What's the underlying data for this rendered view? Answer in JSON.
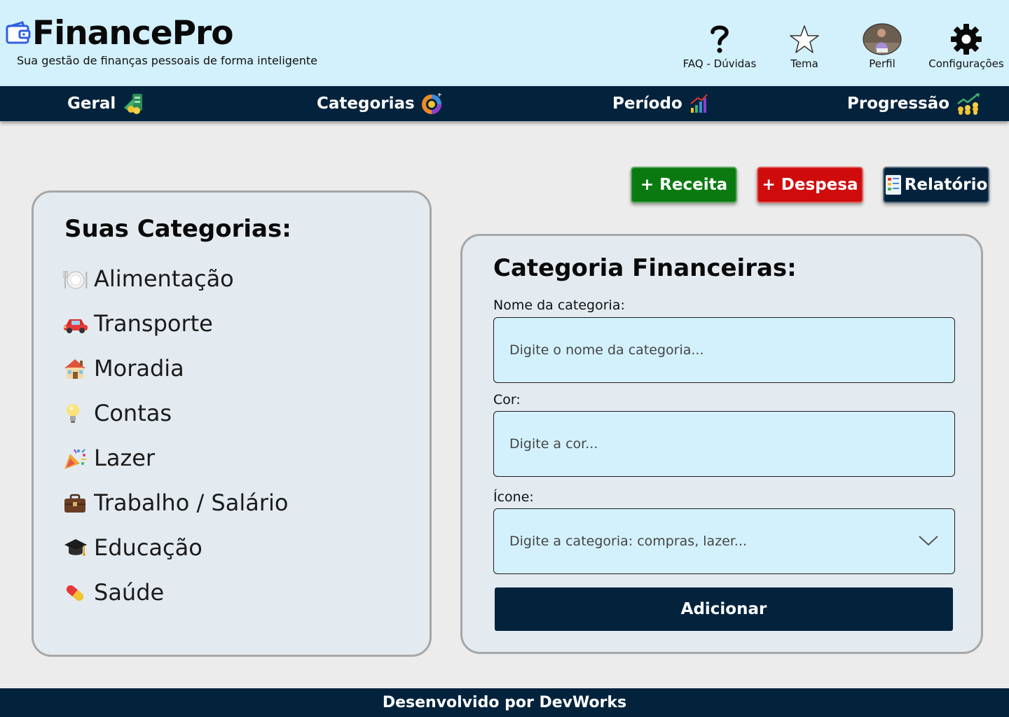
{
  "app": {
    "name": "FinancePro",
    "tagline": "Sua gestão de finanças pessoais de forma inteligente",
    "logo_icon": "wallet-icon"
  },
  "header_actions": [
    {
      "label": "FAQ - Dúvidas",
      "icon": "question-mark-icon"
    },
    {
      "label": "Tema",
      "icon": "star-icon"
    },
    {
      "label": "Perfil",
      "icon": "avatar"
    },
    {
      "label": "Configurações",
      "icon": "gear-icon"
    }
  ],
  "nav": [
    {
      "label": "Geral",
      "icon": "money-stack-icon"
    },
    {
      "label": "Categorias",
      "icon": "donut-chart-icon"
    },
    {
      "label": "Período",
      "icon": "bar-chart-icon"
    },
    {
      "label": "Progressão",
      "icon": "growth-chart-icon"
    }
  ],
  "actions": {
    "income": "+ Receita",
    "expense": "+ Despesa",
    "report": "Relatório"
  },
  "categories_panel": {
    "title": "Suas Categorias:",
    "items": [
      {
        "label": "Alimentação",
        "icon": "plate-icon"
      },
      {
        "label": "Transporte",
        "icon": "car-icon"
      },
      {
        "label": "Moradia",
        "icon": "house-icon"
      },
      {
        "label": "Contas",
        "icon": "lightbulb-icon"
      },
      {
        "label": "Lazer",
        "icon": "party-popper-icon"
      },
      {
        "label": "Trabalho / Salário",
        "icon": "briefcase-icon"
      },
      {
        "label": "Educação",
        "icon": "graduation-cap-icon"
      },
      {
        "label": "Saúde",
        "icon": "pill-icon"
      }
    ]
  },
  "form": {
    "title": "Categoria Financeiras:",
    "name_label": "Nome da categoria:",
    "name_placeholder": "Digite o nome da categoria...",
    "color_label": "Cor:",
    "color_placeholder": "Digite a cor...",
    "icon_label": "Ícone:",
    "icon_placeholder": "Digite a categoria: compras, lazer...",
    "submit_label": "Adicionar"
  },
  "footer": {
    "text": "Desenvolvido por DevWorks"
  },
  "colors": {
    "header_bg": "#d3f1fd",
    "navy": "#03233d",
    "income_green": "#0a7a10",
    "expense_red": "#cf0b0b",
    "panel_bg": "#e3ebf1",
    "page_bg": "#ececec"
  }
}
